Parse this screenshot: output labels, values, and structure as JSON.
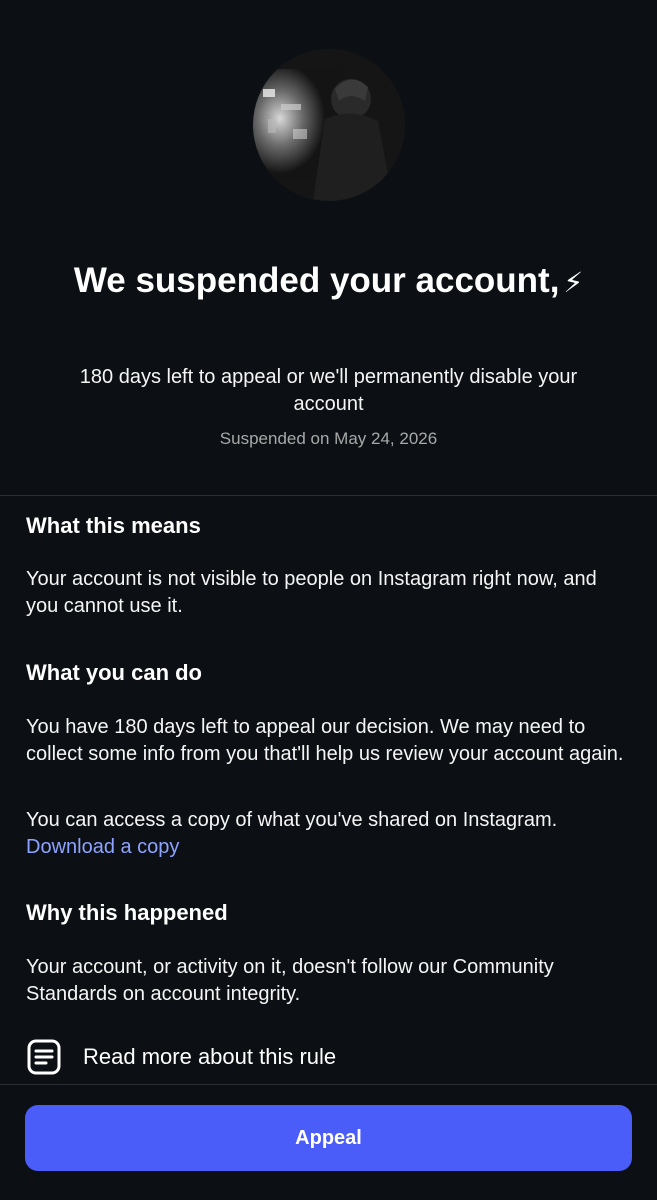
{
  "header": {
    "title": "We suspended your account,",
    "title_emoji": "⚡",
    "subtitle": "180 days left to appeal or we'll permanently disable your account",
    "suspended_date": "Suspended on May 24, 2026"
  },
  "sections": [
    {
      "heading": "What this means",
      "paragraphs": [
        {
          "text": "Your account is not visible to people on Instagram right now, and you cannot use it."
        }
      ]
    },
    {
      "heading": "What you can do",
      "paragraphs": [
        {
          "text": "You have 180 days left to appeal our decision. We may need to collect some info from you that'll help us review your account again."
        },
        {
          "text": "You can access a copy of what you've shared on Instagram.",
          "link": "Download a copy"
        }
      ]
    },
    {
      "heading": "Why this happened",
      "paragraphs": [
        {
          "text": "Your account, or activity on it, doesn't follow our Community Standards on account integrity."
        }
      ]
    }
  ],
  "rule_link": {
    "label": "Read more about this rule",
    "icon": "document-icon"
  },
  "appeal_button": {
    "label": "Appeal"
  },
  "colors": {
    "background": "#0c1014",
    "accent": "#4a5df9",
    "link": "#8ea3ff",
    "muted_text": "#a8a8a8"
  }
}
